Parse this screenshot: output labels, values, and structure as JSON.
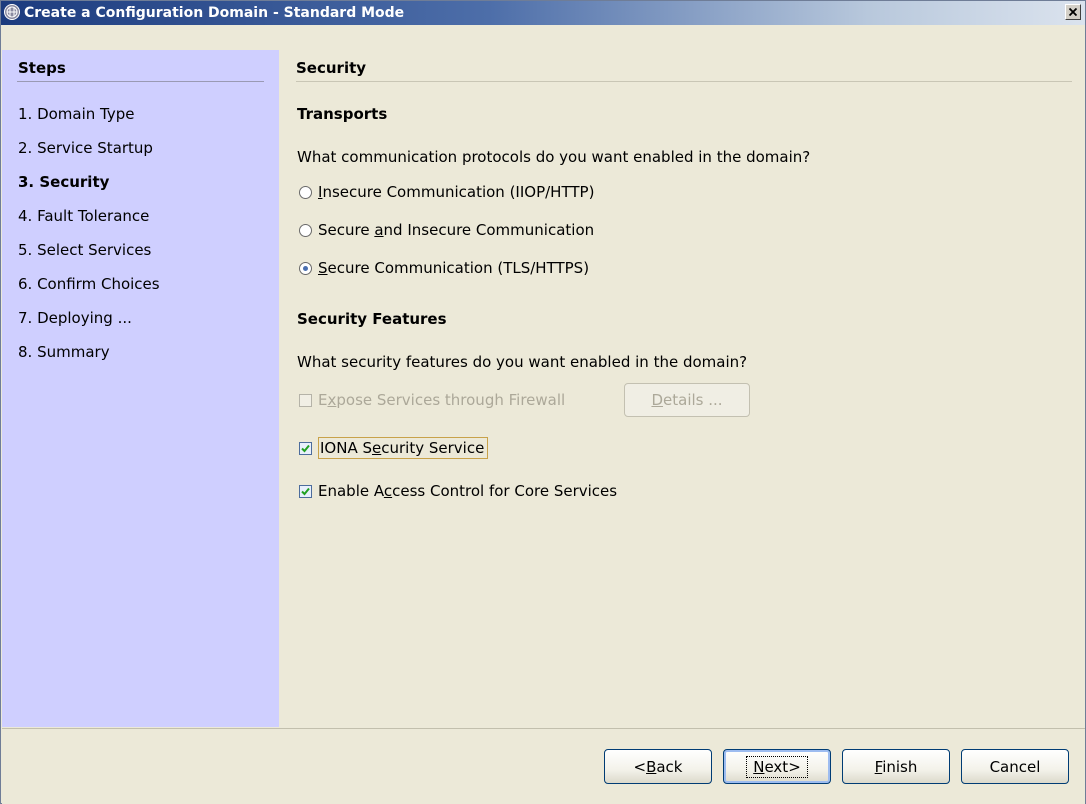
{
  "window": {
    "title": "Create a Configuration Domain - Standard Mode",
    "close_symbol": "×"
  },
  "sidebar": {
    "heading": "Steps",
    "steps": [
      {
        "label": "1. Domain Type",
        "current": false
      },
      {
        "label": "2. Service Startup",
        "current": false
      },
      {
        "label": "3. Security",
        "current": true
      },
      {
        "label": "4. Fault Tolerance",
        "current": false
      },
      {
        "label": "5. Select Services",
        "current": false
      },
      {
        "label": "6. Confirm Choices",
        "current": false
      },
      {
        "label": "7. Deploying ...",
        "current": false
      },
      {
        "label": "8. Summary",
        "current": false
      }
    ]
  },
  "content": {
    "title": "Security",
    "transports": {
      "heading": "Transports",
      "question": "What communication protocols do you want enabled in the domain?",
      "options": [
        {
          "mnemonic": "I",
          "rest": "nsecure Communication (IIOP/HTTP)",
          "before": "",
          "checked": false
        },
        {
          "before": "Secure ",
          "mnemonic": "a",
          "rest": "nd Insecure Communication",
          "checked": false
        },
        {
          "mnemonic": "S",
          "rest": "ecure Communication (TLS/HTTPS)",
          "before": "",
          "checked": true
        }
      ]
    },
    "features": {
      "heading": "Security Features",
      "question": "What security features do you want enabled in the domain?",
      "firewall": {
        "before": "E",
        "mnemonic": "x",
        "rest": "pose Services through Firewall",
        "checked": false,
        "enabled": false
      },
      "details_button": {
        "mnemonic": "D",
        "rest": "etails ...",
        "enabled": false
      },
      "iona": {
        "before": "IONA S",
        "mnemonic": "e",
        "rest": "curity Service",
        "checked": true
      },
      "access": {
        "before": "Enable A",
        "mnemonic": "c",
        "rest": "cess Control for Core Services",
        "checked": true
      }
    }
  },
  "footer": {
    "back": {
      "before": "<",
      "mnemonic": "B",
      "rest": "ack"
    },
    "next": {
      "before": "",
      "mnemonic": "N",
      "rest": "ext>"
    },
    "finish": {
      "before": "",
      "mnemonic": "F",
      "rest": "inish"
    },
    "cancel": {
      "label": "Cancel"
    }
  },
  "colors": {
    "sidebar_bg": "#cfcfff",
    "titlebar_start": "#1c3b7e",
    "dialog_bg": "#ece9d8"
  }
}
